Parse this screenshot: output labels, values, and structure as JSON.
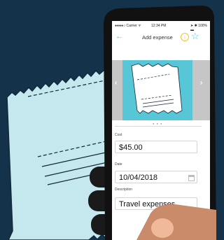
{
  "status": {
    "carrier": "●●●●○ Carrier ᯤ",
    "time": "12:34 PM",
    "battery": "➤ ✱ 100% ▬"
  },
  "header": {
    "back_icon": "back-arrow-icon",
    "title": "Add expense",
    "info_icon": "info-icon",
    "favorite_icon": "star-icon"
  },
  "carousel": {
    "prev_icon": "chevron-left-icon",
    "next_icon": "chevron-right-icon",
    "dots": "● ● ●",
    "active_index": 1,
    "count": 3
  },
  "form": {
    "cost_label": "Cost",
    "cost_value": "$45.00",
    "date_label": "Date",
    "date_value": "10/04/2018",
    "description_label": "Description",
    "description_value": "Travel expenses"
  },
  "colors": {
    "background": "#14324a",
    "receipt": "#c5e8ef",
    "accent": "#57c6d6",
    "info": "#f5c236",
    "phone_body": "#111111",
    "skin": "#c98b6a"
  }
}
